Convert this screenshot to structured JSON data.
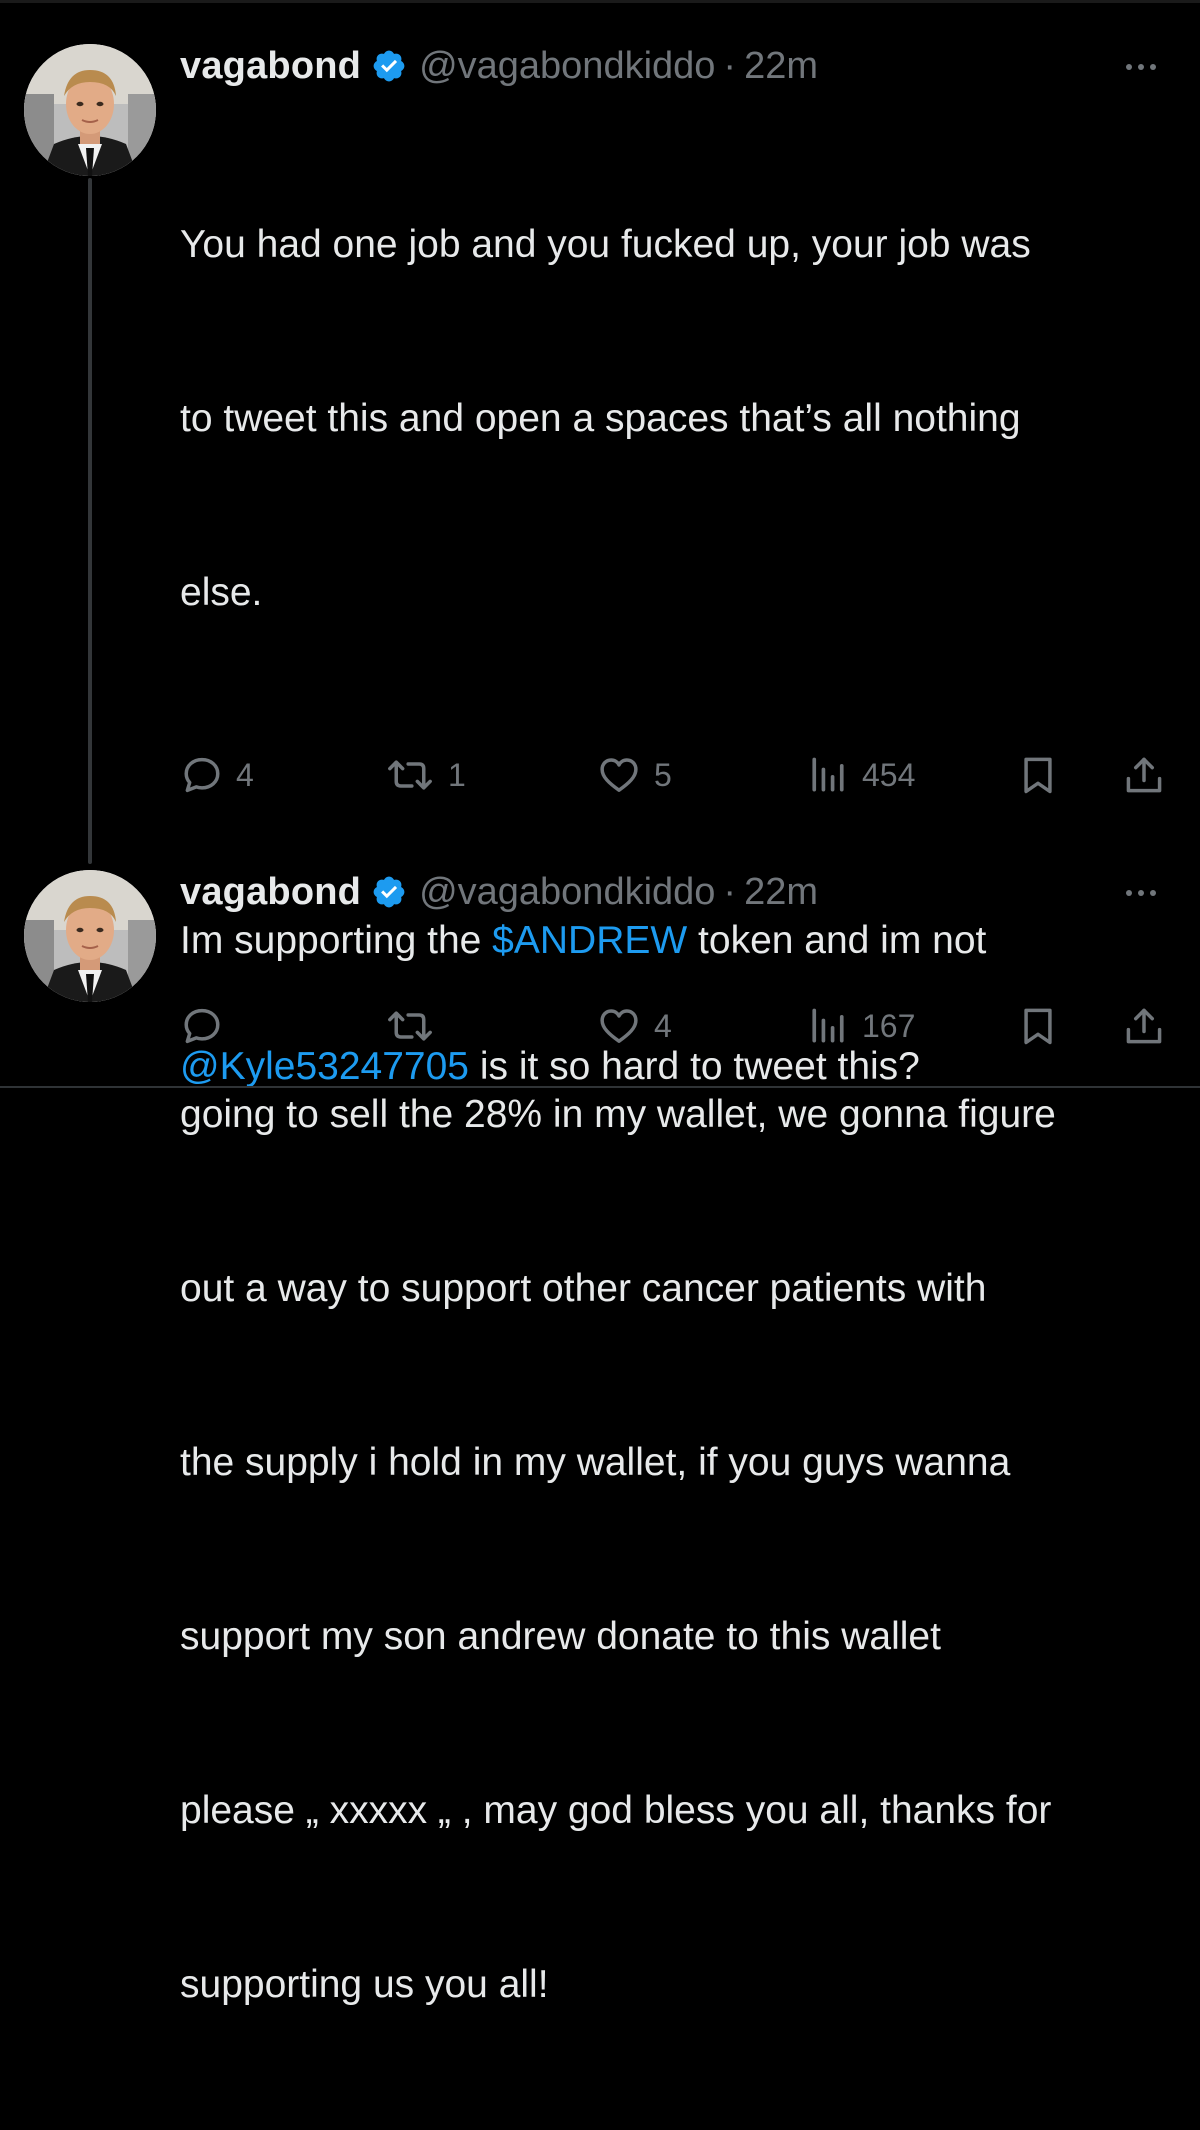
{
  "tweets": [
    {
      "author": {
        "name": "vagabond",
        "handle": "@vagabondkiddo",
        "separator": "·",
        "time": "22m"
      },
      "text": {
        "line1": "You had one job and you fucked up, your job was",
        "line2": "to tweet this and open a spaces that’s all nothing",
        "line3": "else.",
        "para2_pre": "Im supporting the ",
        "cashtag": "$ANDREW",
        "para2_post": " token and im not",
        "line5": "going to sell the 28% in my wallet, we gonna figure",
        "line6": "out a way to support other cancer patients with",
        "line7": "the supply i hold in my wallet, if you guys wanna",
        "line8": "support my son andrew donate to this wallet",
        "line9": "please „ xxxxx „ , may god bless you all, thanks for",
        "line10": "supporting us you all!"
      },
      "actions": {
        "replies": "4",
        "reposts": "1",
        "likes": "5",
        "views": "454"
      }
    },
    {
      "author": {
        "name": "vagabond",
        "handle": "@vagabondkiddo",
        "separator": "·",
        "time": "22m"
      },
      "text": {
        "mention": "@Kyle53247705",
        "rest": " is it so hard to tweet this?"
      },
      "actions": {
        "replies": "",
        "reposts": "",
        "likes": "4",
        "views": "167"
      }
    }
  ],
  "colors": {
    "background": "#000000",
    "text": "#e7e9ea",
    "secondary": "#71767b",
    "link": "#1d9bf0",
    "verified": "#1d9bf0",
    "thread_line": "#333639"
  },
  "icons": [
    "verified-badge-icon",
    "more-options-icon",
    "reply-icon",
    "repost-icon",
    "like-icon",
    "views-icon",
    "bookmark-icon",
    "share-icon"
  ]
}
